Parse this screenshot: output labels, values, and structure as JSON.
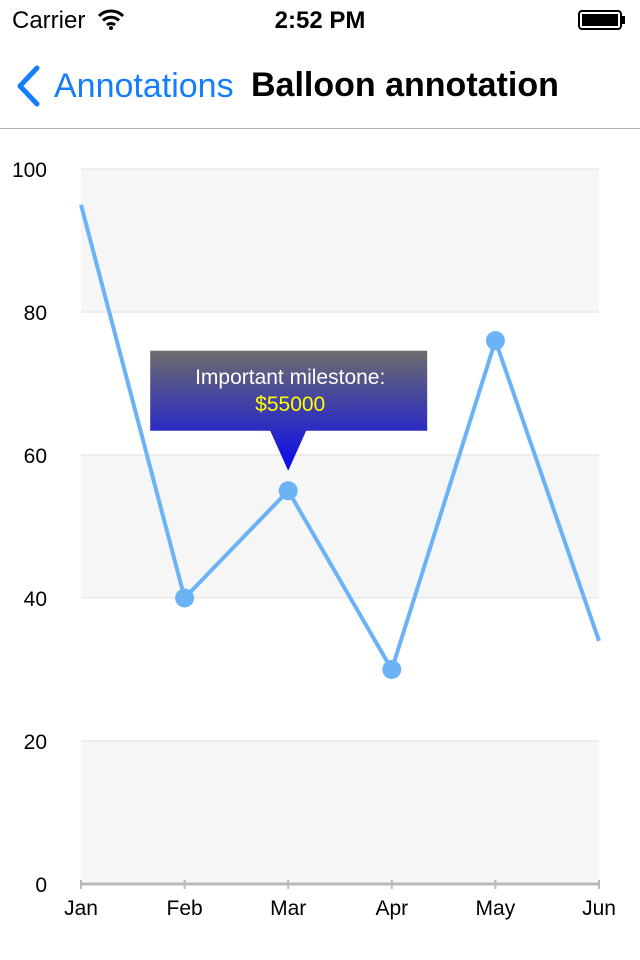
{
  "status_bar": {
    "carrier": "Carrier",
    "time": "2:52 PM"
  },
  "nav": {
    "back_label": "Annotations",
    "title": "Balloon annotation"
  },
  "annotation": {
    "line1": "Important milestone:",
    "line2": "$55000",
    "target_category": "Mar",
    "target_value": 55
  },
  "chart_data": {
    "type": "line",
    "categories": [
      "Jan",
      "Feb",
      "Mar",
      "Apr",
      "May",
      "Jun"
    ],
    "series": [
      {
        "values": [
          95,
          40,
          55,
          30,
          76,
          34
        ]
      }
    ],
    "ylim": [
      0,
      100
    ],
    "yticks": [
      "0",
      "20",
      "40",
      "60",
      "80",
      "100"
    ],
    "grid": true,
    "bullets_on": [
      "Feb",
      "Mar",
      "Apr",
      "May"
    ],
    "colors": {
      "line": "#6cb3f5",
      "band": "#f6f6f6",
      "grid": "#e8e8e8",
      "balloon_top": "#6c6c6c",
      "balloon_bottom": "#0a0af0",
      "balloon_value": "#ffff00"
    }
  }
}
